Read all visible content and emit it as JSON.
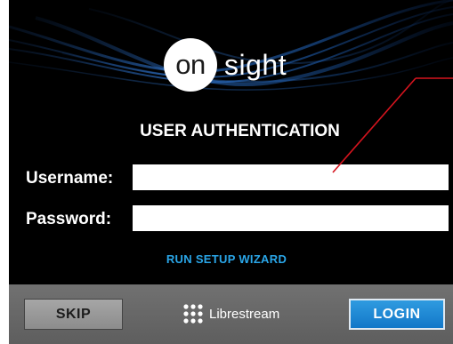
{
  "logo": {
    "circle_text": "on",
    "word": "sight"
  },
  "auth": {
    "heading": "USER AUTHENTICATION",
    "username_label": "Username:",
    "username_value": "",
    "password_label": "Password:",
    "password_value": "",
    "wizard_link": "RUN SETUP WIZARD"
  },
  "footer": {
    "skip_label": "SKIP",
    "brand_name": "Librestream",
    "login_label": "LOGIN"
  },
  "colors": {
    "accent_blue": "#2aa6e8",
    "login_button": "#1a86d4",
    "annotation_red": "#d5141e",
    "footer_gray": "#686868"
  },
  "icons": {
    "brand_logo": "librestream-dots-icon"
  }
}
